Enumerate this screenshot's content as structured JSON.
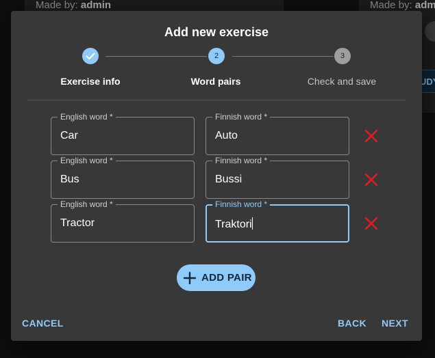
{
  "background": {
    "card_left_madeby": "Made by:",
    "card_left_author": "admin",
    "card_right_madeby": "Made by:",
    "card_right_author": "admin",
    "card_right_button": "UDY"
  },
  "dialog": {
    "title": "Add new exercise",
    "steps": [
      {
        "number": "1",
        "label": "Exercise info",
        "state": "completed"
      },
      {
        "number": "2",
        "label": "Word pairs",
        "state": "active"
      },
      {
        "number": "3",
        "label": "Check and save",
        "state": "pending"
      }
    ],
    "pairs": [
      {
        "english_label": "English word *",
        "english_value": "Car",
        "finnish_label": "Finnish word *",
        "finnish_value": "Auto"
      },
      {
        "english_label": "English word *",
        "english_value": "Bus",
        "finnish_label": "Finnish word *",
        "finnish_value": "Bussi"
      },
      {
        "english_label": "English word *",
        "english_value": "Tractor",
        "finnish_label": "Finnish word *",
        "finnish_value": "Traktori"
      }
    ],
    "add_pair_label": "ADD PAIR",
    "cancel_label": "CANCEL",
    "back_label": "BACK",
    "next_label": "NEXT"
  },
  "colors": {
    "accent": "#90caf9",
    "delete": "#e01e1e",
    "dialog_bg": "#383838"
  }
}
